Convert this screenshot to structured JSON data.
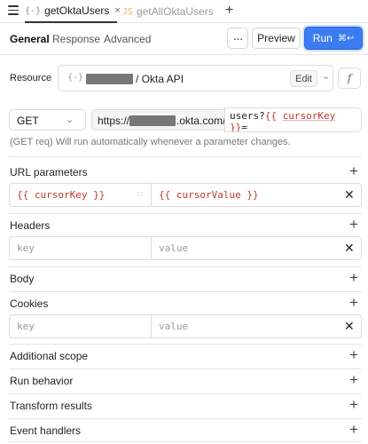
{
  "tabs": [
    {
      "icon": "{-}",
      "label": "getOktaUsers",
      "close": "×"
    },
    {
      "icon": "JS",
      "label": "getAllOktaUsers"
    }
  ],
  "new_tab": "+",
  "subtabs": [
    "General",
    "Response",
    "Advanced"
  ],
  "toolbar": {
    "more": "···",
    "preview": "Preview",
    "run": "Run",
    "run_shortcut": "⌘↩"
  },
  "resource": {
    "label": "Resource",
    "icon": "{-}",
    "name": "/ Okta API",
    "edit": "Edit",
    "chevron": "⌄",
    "fx": "f"
  },
  "request": {
    "method": "GET",
    "method_chevron": "⌄",
    "url_start": "https://",
    "url_end": ".okta.com/a",
    "path_text": "users?",
    "param_key": "cursorKey",
    "param_value": "cursorValue",
    "open": "{{",
    "close": "}}",
    "eq": "=",
    "hint": "(GET req) Will run automatically whenever a parameter changes."
  },
  "sections": {
    "url_params": {
      "title": "URL parameters",
      "key": "{{ cursorKey }}",
      "value": "{{ cursorValue }}"
    },
    "headers": {
      "title": "Headers",
      "key_placeholder": "key",
      "value_placeholder": "value"
    },
    "body": {
      "title": "Body"
    },
    "cookies": {
      "title": "Cookies",
      "key_placeholder": "key",
      "value_placeholder": "value"
    },
    "additional_scope": {
      "title": "Additional scope"
    },
    "run_behavior": {
      "title": "Run behavior"
    },
    "transform_results": {
      "title": "Transform results"
    },
    "event_handlers": {
      "title": "Event handlers"
    }
  },
  "icons": {
    "plus": "+",
    "remove": "✕"
  },
  "colors": {
    "accent": "#3b7df0",
    "template": "#c0392b"
  }
}
